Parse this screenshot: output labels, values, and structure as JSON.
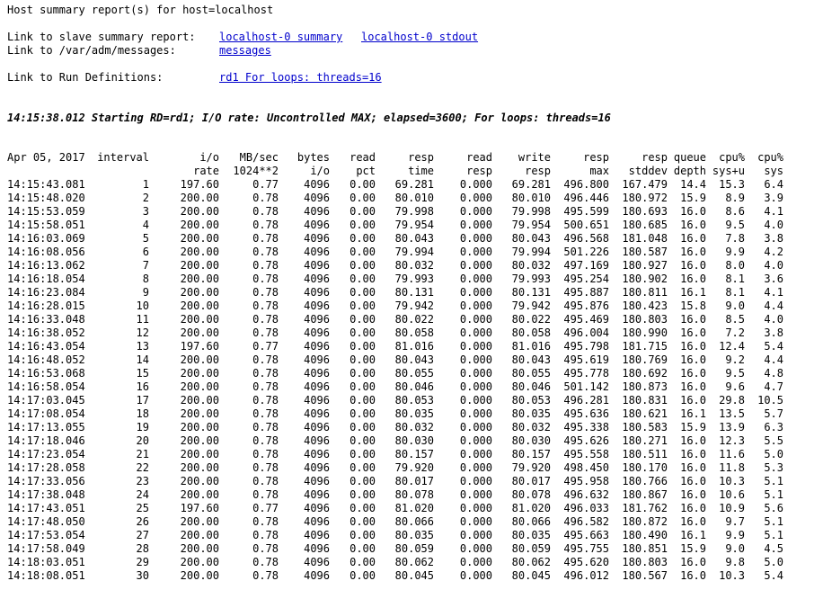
{
  "header": {
    "title": "Host summary report(s) for host=localhost",
    "slave_label": "Link to slave summary report:",
    "slave_links": [
      "localhost-0 summary",
      "localhost-0 stdout"
    ],
    "messages_label": "Link to /var/adm/messages:",
    "messages_link": "messages",
    "rd_label": "Link to Run Definitions:",
    "rd_link": "rd1 For loops: threads=16",
    "start_line": "14:15:38.012 Starting RD=rd1; I/O rate: Uncontrolled MAX; elapsed=3600; For loops: threads=16"
  },
  "table": {
    "header_row1": [
      "Apr 05, 2017",
      "interval",
      "i/o",
      "MB/sec",
      "bytes",
      "read",
      "resp",
      "read",
      "write",
      "resp",
      "resp",
      "queue",
      "cpu%",
      "cpu%"
    ],
    "header_row2": [
      "",
      "",
      "rate",
      "1024**2",
      "i/o",
      "pct",
      "time",
      "resp",
      "resp",
      "max",
      "stddev",
      "depth",
      "sys+u",
      "sys"
    ],
    "rows": [
      [
        "14:15:43.081",
        "1",
        "197.60",
        "0.77",
        "4096",
        "0.00",
        "69.281",
        "0.000",
        "69.281",
        "496.800",
        "167.479",
        "14.4",
        "15.3",
        "6.4"
      ],
      [
        "14:15:48.020",
        "2",
        "200.00",
        "0.78",
        "4096",
        "0.00",
        "80.010",
        "0.000",
        "80.010",
        "496.446",
        "180.972",
        "15.9",
        "8.9",
        "3.9"
      ],
      [
        "14:15:53.059",
        "3",
        "200.00",
        "0.78",
        "4096",
        "0.00",
        "79.998",
        "0.000",
        "79.998",
        "495.599",
        "180.693",
        "16.0",
        "8.6",
        "4.1"
      ],
      [
        "14:15:58.051",
        "4",
        "200.00",
        "0.78",
        "4096",
        "0.00",
        "79.954",
        "0.000",
        "79.954",
        "500.651",
        "180.685",
        "16.0",
        "9.5",
        "4.0"
      ],
      [
        "14:16:03.069",
        "5",
        "200.00",
        "0.78",
        "4096",
        "0.00",
        "80.043",
        "0.000",
        "80.043",
        "496.568",
        "181.048",
        "16.0",
        "7.8",
        "3.8"
      ],
      [
        "14:16:08.056",
        "6",
        "200.00",
        "0.78",
        "4096",
        "0.00",
        "79.994",
        "0.000",
        "79.994",
        "501.226",
        "180.587",
        "16.0",
        "9.9",
        "4.2"
      ],
      [
        "14:16:13.062",
        "7",
        "200.00",
        "0.78",
        "4096",
        "0.00",
        "80.032",
        "0.000",
        "80.032",
        "497.169",
        "180.927",
        "16.0",
        "8.0",
        "4.0"
      ],
      [
        "14:16:18.054",
        "8",
        "200.00",
        "0.78",
        "4096",
        "0.00",
        "79.993",
        "0.000",
        "79.993",
        "495.254",
        "180.902",
        "16.0",
        "8.1",
        "3.6"
      ],
      [
        "14:16:23.084",
        "9",
        "200.00",
        "0.78",
        "4096",
        "0.00",
        "80.131",
        "0.000",
        "80.131",
        "495.887",
        "180.811",
        "16.1",
        "8.1",
        "4.1"
      ],
      [
        "14:16:28.015",
        "10",
        "200.00",
        "0.78",
        "4096",
        "0.00",
        "79.942",
        "0.000",
        "79.942",
        "495.876",
        "180.423",
        "15.8",
        "9.0",
        "4.4"
      ],
      [
        "14:16:33.048",
        "11",
        "200.00",
        "0.78",
        "4096",
        "0.00",
        "80.022",
        "0.000",
        "80.022",
        "495.469",
        "180.803",
        "16.0",
        "8.5",
        "4.0"
      ],
      [
        "14:16:38.052",
        "12",
        "200.00",
        "0.78",
        "4096",
        "0.00",
        "80.058",
        "0.000",
        "80.058",
        "496.004",
        "180.990",
        "16.0",
        "7.2",
        "3.8"
      ],
      [
        "14:16:43.054",
        "13",
        "197.60",
        "0.77",
        "4096",
        "0.00",
        "81.016",
        "0.000",
        "81.016",
        "495.798",
        "181.715",
        "16.0",
        "12.4",
        "5.4"
      ],
      [
        "14:16:48.052",
        "14",
        "200.00",
        "0.78",
        "4096",
        "0.00",
        "80.043",
        "0.000",
        "80.043",
        "495.619",
        "180.769",
        "16.0",
        "9.2",
        "4.4"
      ],
      [
        "14:16:53.068",
        "15",
        "200.00",
        "0.78",
        "4096",
        "0.00",
        "80.055",
        "0.000",
        "80.055",
        "495.778",
        "180.692",
        "16.0",
        "9.5",
        "4.8"
      ],
      [
        "14:16:58.054",
        "16",
        "200.00",
        "0.78",
        "4096",
        "0.00",
        "80.046",
        "0.000",
        "80.046",
        "501.142",
        "180.873",
        "16.0",
        "9.6",
        "4.7"
      ],
      [
        "14:17:03.045",
        "17",
        "200.00",
        "0.78",
        "4096",
        "0.00",
        "80.053",
        "0.000",
        "80.053",
        "496.281",
        "180.831",
        "16.0",
        "29.8",
        "10.5"
      ],
      [
        "14:17:08.054",
        "18",
        "200.00",
        "0.78",
        "4096",
        "0.00",
        "80.035",
        "0.000",
        "80.035",
        "495.636",
        "180.621",
        "16.1",
        "13.5",
        "5.7"
      ],
      [
        "14:17:13.055",
        "19",
        "200.00",
        "0.78",
        "4096",
        "0.00",
        "80.032",
        "0.000",
        "80.032",
        "495.338",
        "180.583",
        "15.9",
        "13.9",
        "6.3"
      ],
      [
        "14:17:18.046",
        "20",
        "200.00",
        "0.78",
        "4096",
        "0.00",
        "80.030",
        "0.000",
        "80.030",
        "495.626",
        "180.271",
        "16.0",
        "12.3",
        "5.5"
      ],
      [
        "14:17:23.054",
        "21",
        "200.00",
        "0.78",
        "4096",
        "0.00",
        "80.157",
        "0.000",
        "80.157",
        "495.558",
        "180.511",
        "16.0",
        "11.6",
        "5.0"
      ],
      [
        "14:17:28.058",
        "22",
        "200.00",
        "0.78",
        "4096",
        "0.00",
        "79.920",
        "0.000",
        "79.920",
        "498.450",
        "180.170",
        "16.0",
        "11.8",
        "5.3"
      ],
      [
        "14:17:33.056",
        "23",
        "200.00",
        "0.78",
        "4096",
        "0.00",
        "80.017",
        "0.000",
        "80.017",
        "495.958",
        "180.766",
        "16.0",
        "10.3",
        "5.1"
      ],
      [
        "14:17:38.048",
        "24",
        "200.00",
        "0.78",
        "4096",
        "0.00",
        "80.078",
        "0.000",
        "80.078",
        "496.632",
        "180.867",
        "16.0",
        "10.6",
        "5.1"
      ],
      [
        "14:17:43.051",
        "25",
        "197.60",
        "0.77",
        "4096",
        "0.00",
        "81.020",
        "0.000",
        "81.020",
        "496.033",
        "181.762",
        "16.0",
        "10.9",
        "5.6"
      ],
      [
        "14:17:48.050",
        "26",
        "200.00",
        "0.78",
        "4096",
        "0.00",
        "80.066",
        "0.000",
        "80.066",
        "496.582",
        "180.872",
        "16.0",
        "9.7",
        "5.1"
      ],
      [
        "14:17:53.054",
        "27",
        "200.00",
        "0.78",
        "4096",
        "0.00",
        "80.035",
        "0.000",
        "80.035",
        "495.663",
        "180.490",
        "16.1",
        "9.9",
        "5.1"
      ],
      [
        "14:17:58.049",
        "28",
        "200.00",
        "0.78",
        "4096",
        "0.00",
        "80.059",
        "0.000",
        "80.059",
        "495.755",
        "180.851",
        "15.9",
        "9.0",
        "4.5"
      ],
      [
        "14:18:03.051",
        "29",
        "200.00",
        "0.78",
        "4096",
        "0.00",
        "80.062",
        "0.000",
        "80.062",
        "495.620",
        "180.803",
        "16.0",
        "9.8",
        "5.0"
      ],
      [
        "14:18:08.051",
        "30",
        "200.00",
        "0.78",
        "4096",
        "0.00",
        "80.045",
        "0.000",
        "80.045",
        "496.012",
        "180.567",
        "16.0",
        "10.3",
        "5.4"
      ]
    ]
  }
}
